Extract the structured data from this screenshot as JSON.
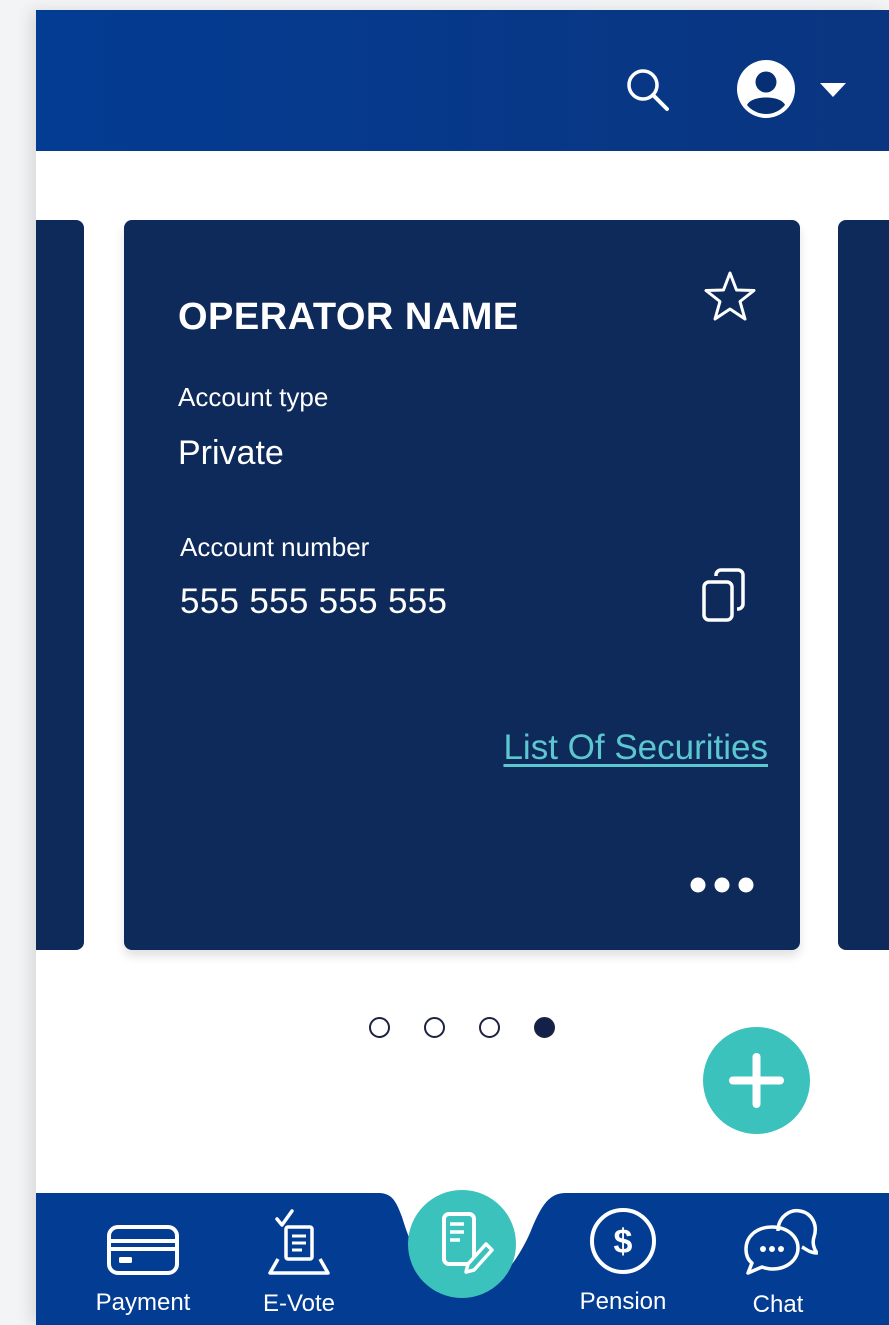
{
  "card": {
    "operator_name": "OPERATOR NAME",
    "account_type_label": "Account type",
    "account_type_value": "Private",
    "account_number_label": "Account number",
    "account_number_value": "555 555 555 555",
    "securities_link": "List Of Securities"
  },
  "pagination": {
    "total": 4,
    "active_index": 3
  },
  "bottom_nav": {
    "items": [
      {
        "label": "Payment",
        "icon": "credit-card-icon"
      },
      {
        "label": "E-Vote",
        "icon": "ballot-box-icon"
      },
      {
        "label": "",
        "icon": "document-edit-icon"
      },
      {
        "label": "Pension",
        "icon": "dollar-circle-icon"
      },
      {
        "label": "Chat",
        "icon": "chat-bubbles-icon"
      }
    ]
  },
  "colors": {
    "header_blue": "#033c93",
    "card_navy": "#0e2a5a",
    "accent_teal": "#3cc2bd",
    "link_teal": "#5cc7cf"
  }
}
